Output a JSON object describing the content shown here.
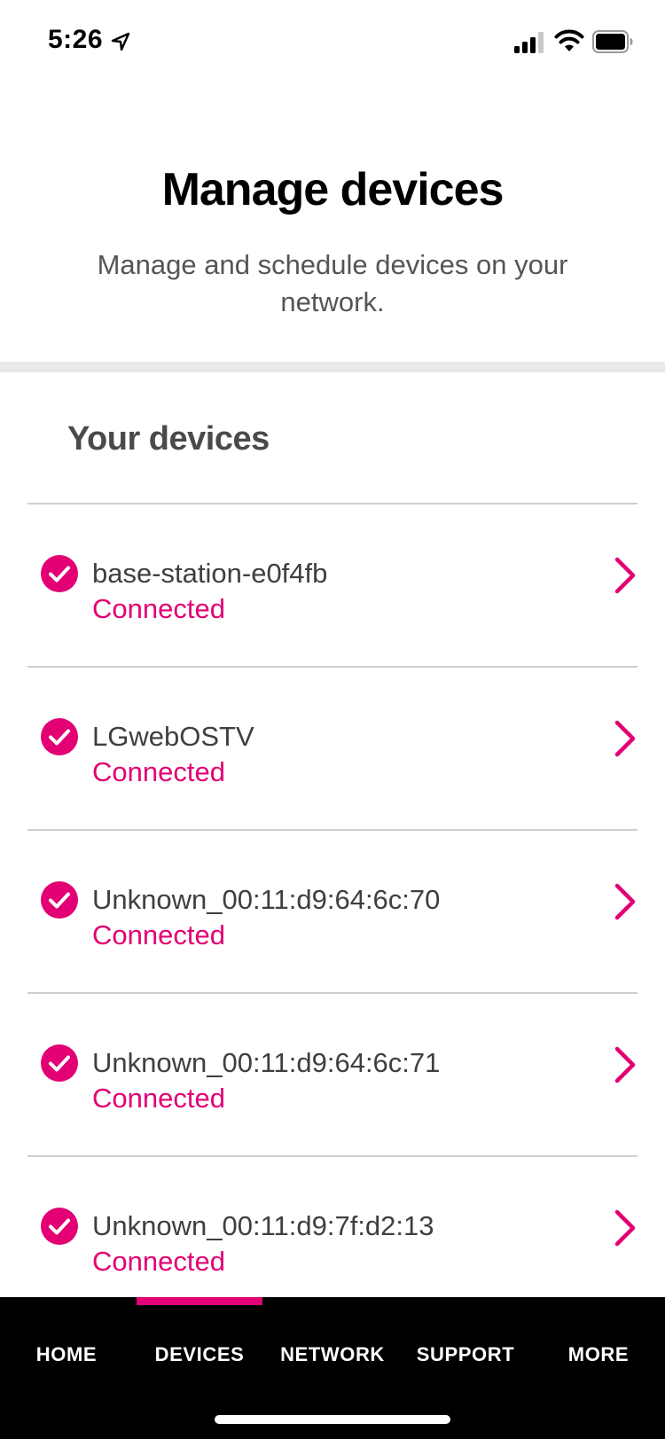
{
  "status_bar": {
    "time": "5:26",
    "icons": [
      "location-arrow-icon",
      "cellular-signal-icon",
      "wifi-icon",
      "battery-icon"
    ]
  },
  "header": {
    "title": "Manage devices",
    "subtitle": "Manage and schedule devices on your network."
  },
  "devices_section": {
    "title": "Your devices",
    "items": [
      {
        "name": "base-station-e0f4fb",
        "status": "Connected"
      },
      {
        "name": "LGwebOSTV",
        "status": "Connected"
      },
      {
        "name": "Unknown_00:11:d9:64:6c:70",
        "status": "Connected"
      },
      {
        "name": "Unknown_00:11:d9:64:6c:71",
        "status": "Connected"
      },
      {
        "name": "Unknown_00:11:d9:7f:d2:13",
        "status": "Connected"
      }
    ]
  },
  "bottom_nav": {
    "tabs": [
      {
        "label": "HOME"
      },
      {
        "label": "DEVICES"
      },
      {
        "label": "NETWORK"
      },
      {
        "label": "SUPPORT"
      },
      {
        "label": "MORE"
      }
    ],
    "selected": "DEVICES"
  },
  "colors": {
    "accent": "#e20074",
    "nav_background": "#000000",
    "section_divider": "#e9e9e9"
  }
}
